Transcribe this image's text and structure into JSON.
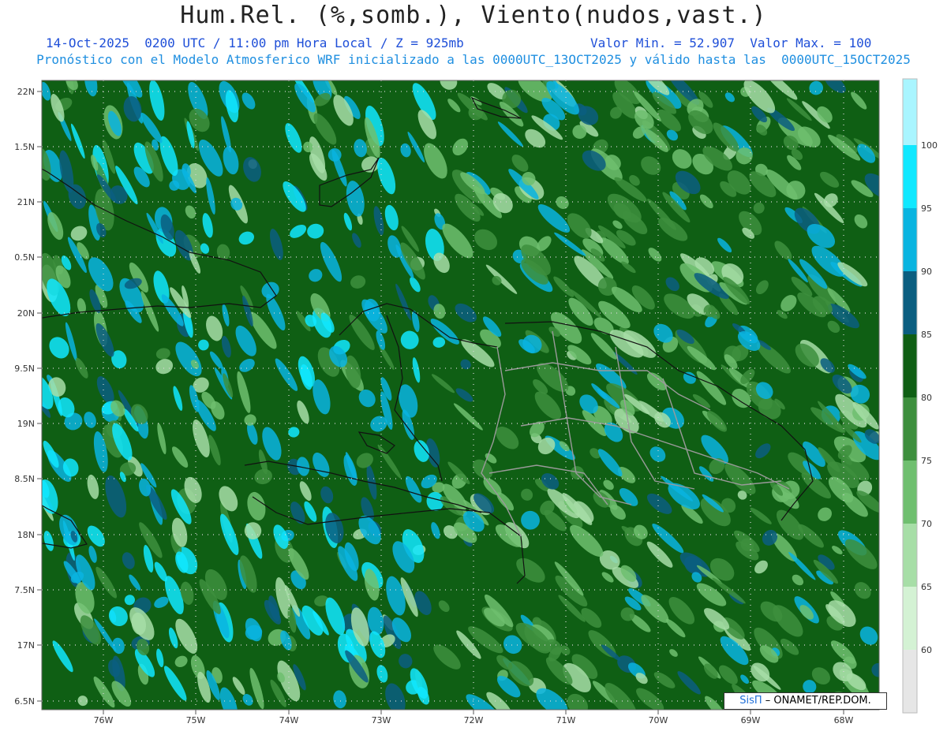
{
  "header": {
    "title": "Hum.Rel. (%,somb.), Viento(nudos,vast.)",
    "date_line": "14-Oct-2025  0200 UTC / 11:00 pm Hora Local / Z = 925mb",
    "minmax_line": "Valor Min. = 52.907  Valor Max. = 100",
    "model_line": "Pronóstico con el Modelo Atmosferico WRF inicializado a las 0000UTC_13OCT2025 y válido hasta las  0000UTC_15OCT2025"
  },
  "map": {
    "lat_labels": [
      "22N",
      "1.5N",
      "21N",
      "0.5N",
      "20N",
      "9.5N",
      "19N",
      "8.5N",
      "18N",
      "7.5N",
      "17N",
      "6.5N"
    ],
    "lon_labels": [
      "76W",
      "75W",
      "74W",
      "73W",
      "72W",
      "71W",
      "70W",
      "69W",
      "68W"
    ]
  },
  "legend": {
    "labels": [
      "60",
      "65",
      "70",
      "75",
      "80",
      "85",
      "90",
      "95",
      "100"
    ],
    "colors": [
      "#e6e6e6",
      "#d4f2d4",
      "#a7dea7",
      "#6fbf6f",
      "#3d8f3d",
      "#0f5f14",
      "#0b5e80",
      "#09b4e0",
      "#10e8ff",
      "#a9f5ff"
    ]
  },
  "credit": {
    "brand": "SisΠ",
    "text": "– ONAMET/REP.DOM."
  }
}
